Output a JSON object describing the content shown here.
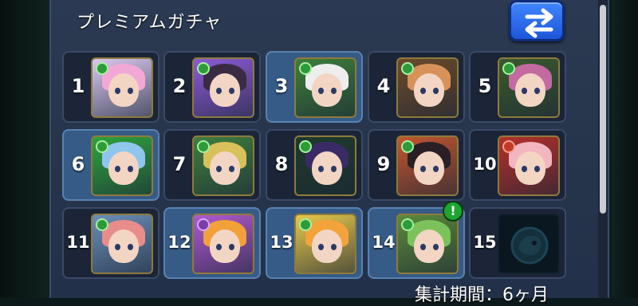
{
  "screen": {
    "title": "プレミアムガチャ",
    "footer": "集計期間：6ヶ月"
  },
  "slots": [
    {
      "number": "1",
      "hair": "#f2a8d6",
      "bg": "#d9c9ef",
      "badge": "green",
      "highlight": false
    },
    {
      "number": "2",
      "hair": "#3a2b45",
      "bg": "#8d5bd6",
      "badge": "green",
      "highlight": false
    },
    {
      "number": "3",
      "hair": "#eeeeee",
      "bg": "#3d7e3a",
      "badge": "green",
      "highlight": true
    },
    {
      "number": "4",
      "hair": "#d9915a",
      "bg": "#6b4b2a",
      "badge": "green",
      "highlight": false
    },
    {
      "number": "5",
      "hair": "#c46aa0",
      "bg": "#3b5a2c",
      "badge": "green",
      "highlight": false
    },
    {
      "number": "6",
      "hair": "#8fc6ec",
      "bg": "#2fa33c",
      "badge": "green",
      "highlight": true
    },
    {
      "number": "7",
      "hair": "#d8c05a",
      "bg": "#3f7e3e",
      "badge": "green",
      "highlight": false
    },
    {
      "number": "8",
      "hair": "#3a2a66",
      "bg": "#1f3b2a",
      "badge": "green",
      "highlight": false
    },
    {
      "number": "9",
      "hair": "#2a1f24",
      "bg": "#c2562f",
      "badge": "green",
      "highlight": false
    },
    {
      "number": "10",
      "hair": "#f3b5c0",
      "bg": "#b4302a",
      "badge": "red",
      "highlight": false
    },
    {
      "number": "11",
      "hair": "#e98c8c",
      "bg": "#6b8fb8",
      "badge": "green",
      "highlight": false
    },
    {
      "number": "12",
      "hair": "#f2a03a",
      "bg": "#b05ad0",
      "badge": "purple",
      "highlight": true
    },
    {
      "number": "13",
      "hair": "#f3a33a",
      "bg": "#e6c84a",
      "badge": "green",
      "highlight": true
    },
    {
      "number": "14",
      "hair": "#7bc25a",
      "bg": "#5c8a3a",
      "badge": "green",
      "highlight": true,
      "alert": "!"
    },
    {
      "number": "15",
      "locked": true,
      "highlight": false
    }
  ],
  "colors": {
    "panel": "#2b3a52",
    "swap_button": "#2f6ff0",
    "accent_green": "#2d9b3a"
  },
  "icons": {
    "swap": "swap-arrows-icon",
    "locked": "monster-silhouette-icon"
  }
}
